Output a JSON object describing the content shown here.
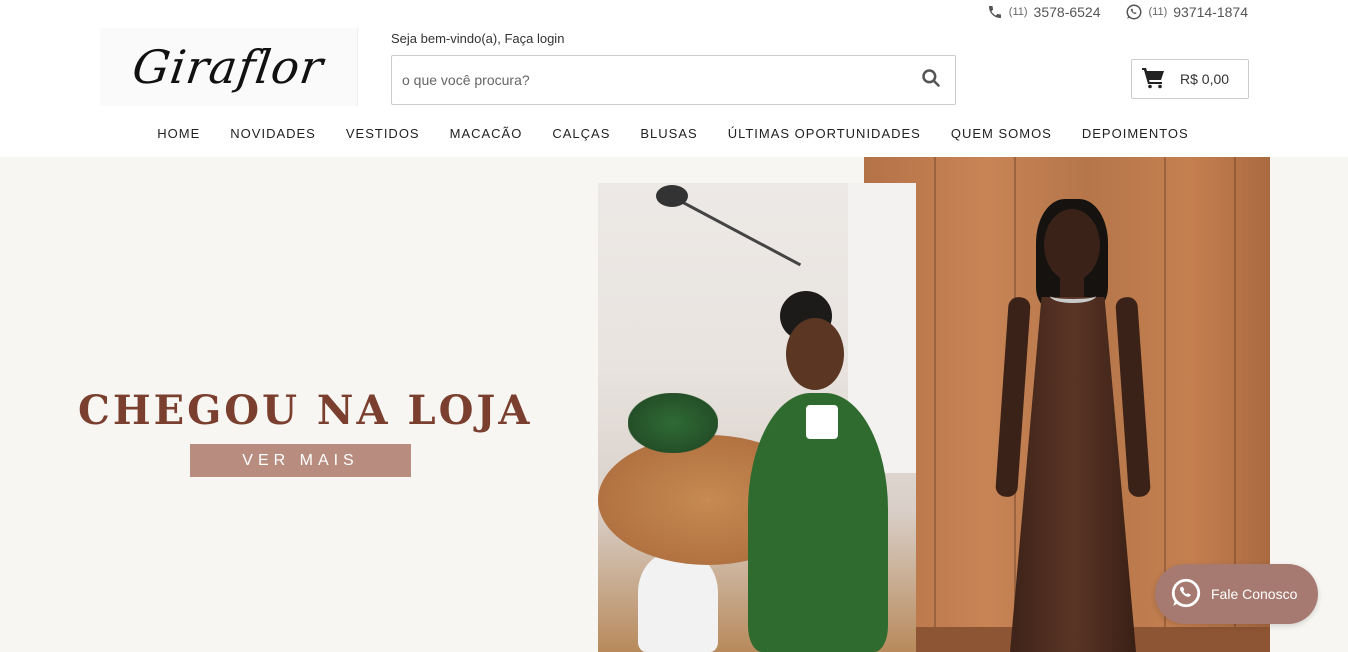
{
  "contact": {
    "phone": {
      "ddd": "(11)",
      "number": "3578-6524",
      "icon": "phone-icon"
    },
    "whatsapp": {
      "ddd": "(11)",
      "number": "93714-1874",
      "icon": "whatsapp-icon"
    }
  },
  "logo": {
    "text": "Giraflor"
  },
  "welcome": {
    "text": "Seja bem-vindo(a), Faça login"
  },
  "search": {
    "placeholder": "o que você procura?",
    "icon": "search-icon"
  },
  "cart": {
    "label": "R$ 0,00",
    "icon": "cart-icon"
  },
  "nav": {
    "items": [
      {
        "label": "HOME"
      },
      {
        "label": "NOVIDADES"
      },
      {
        "label": "VESTIDOS"
      },
      {
        "label": "MACACÃO"
      },
      {
        "label": "CALÇAS"
      },
      {
        "label": "BLUSAS"
      },
      {
        "label": "ÚLTIMAS OPORTUNIDADES"
      },
      {
        "label": "QUEM SOMOS"
      },
      {
        "label": "DEPOIMENTOS"
      }
    ]
  },
  "banner": {
    "headline": "CHEGOU NA LOJA",
    "cta": "VER MAIS",
    "colors": {
      "headline": "#7a3f2e",
      "cta_bg": "#b88d80",
      "background": "#f7f6f2"
    }
  },
  "float": {
    "label": "Fale Conosco",
    "icon": "whatsapp-icon",
    "color": "#a67a70"
  }
}
